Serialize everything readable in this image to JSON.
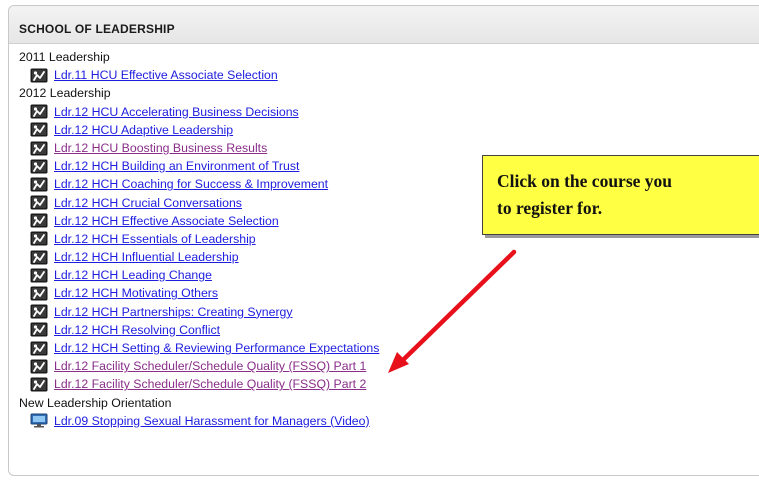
{
  "panel": {
    "title": "SCHOOL OF LEADERSHIP"
  },
  "groups": [
    {
      "label": "2011 Leadership",
      "courses": [
        {
          "label": "Ldr.11 HCU Effective Associate Selection",
          "icon": "leadership-course-icon",
          "visited": false
        }
      ]
    },
    {
      "label": "2012 Leadership",
      "courses": [
        {
          "label": "Ldr.12 HCU Accelerating Business Decisions",
          "icon": "leadership-course-icon",
          "visited": false
        },
        {
          "label": "Ldr.12 HCU Adaptive Leadership",
          "icon": "leadership-course-icon",
          "visited": false
        },
        {
          "label": "Ldr.12 HCU Boosting Business Results",
          "icon": "leadership-course-icon",
          "visited": true
        },
        {
          "label": "Ldr.12 HCH Building an Environment of Trust",
          "icon": "leadership-course-icon",
          "visited": false
        },
        {
          "label": "Ldr.12 HCH Coaching for Success & Improvement",
          "icon": "leadership-course-icon",
          "visited": false
        },
        {
          "label": "Ldr.12 HCH Crucial Conversations",
          "icon": "leadership-course-icon",
          "visited": false
        },
        {
          "label": "Ldr.12 HCH Effective Associate Selection",
          "icon": "leadership-course-icon",
          "visited": false
        },
        {
          "label": "Ldr.12 HCH Essentials of Leadership",
          "icon": "leadership-course-icon",
          "visited": false
        },
        {
          "label": "Ldr.12 HCH Influential Leadership",
          "icon": "leadership-course-icon",
          "visited": false
        },
        {
          "label": "Ldr.12 HCH Leading Change",
          "icon": "leadership-course-icon",
          "visited": false
        },
        {
          "label": "Ldr.12 HCH Motivating Others",
          "icon": "leadership-course-icon",
          "visited": false
        },
        {
          "label": "Ldr.12 HCH Partnerships: Creating Synergy",
          "icon": "leadership-course-icon",
          "visited": false
        },
        {
          "label": "Ldr.12 HCH Resolving Conflict",
          "icon": "leadership-course-icon",
          "visited": false
        },
        {
          "label": "Ldr.12 HCH Setting & Reviewing Performance Expectations",
          "icon": "leadership-course-icon",
          "visited": false
        },
        {
          "label": "Ldr.12 Facility Scheduler/Schedule Quality (FSSQ) Part 1",
          "icon": "leadership-course-icon",
          "visited": true
        },
        {
          "label": "Ldr.12 Facility Scheduler/Schedule Quality (FSSQ) Part 2",
          "icon": "leadership-course-icon",
          "visited": true
        }
      ]
    },
    {
      "label": "New Leadership Orientation",
      "courses": [
        {
          "label": "Ldr.09 Stopping Sexual Harassment for Managers (Video)",
          "icon": "video-course-icon",
          "visited": false
        }
      ]
    }
  ],
  "callout": {
    "text": "Click on the course you\nto register for."
  },
  "colors": {
    "link": "#1d1de0",
    "visited_link": "#8a2e8a",
    "callout_fill": "#ffff44",
    "arrow": "#e8101a"
  }
}
